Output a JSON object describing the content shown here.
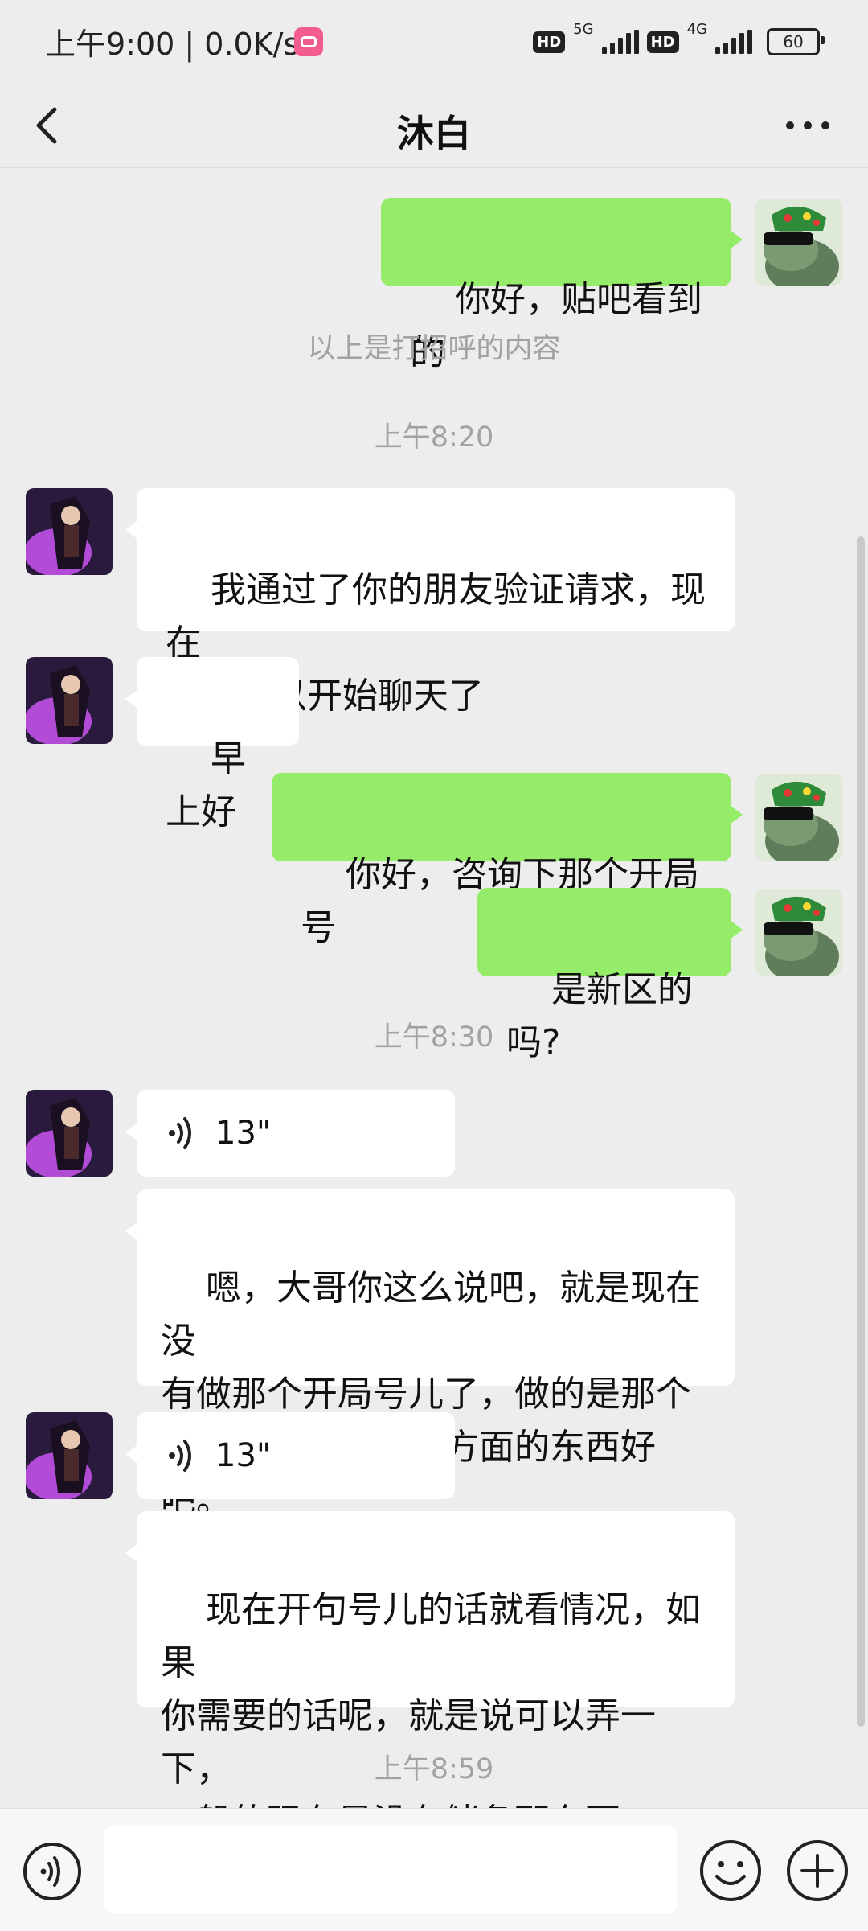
{
  "status_bar": {
    "time_speed": "上午9:00 | 0.0K/s",
    "hd1": "HD",
    "net1": "5G",
    "hd2": "HD",
    "net2": "4G",
    "battery": "60"
  },
  "header": {
    "title": "沐白"
  },
  "messages": {
    "m1": "你好，贴吧看到的",
    "greeting_note": "以上是打招呼的内容",
    "t1": "上午8:20",
    "m2": "我通过了你的朋友验证请求，现在\n我们可以开始聊天了",
    "m3": "早上好",
    "m4": "你好，咨询下那个开局号",
    "m5": "是新区的吗?",
    "t2": "上午8:30",
    "v1": "13\"",
    "m6": "嗯，大哥你这么说吧，就是现在没\n有做那个开局号儿了，做的是那个\n跟充值方充值优惠方面的东西好吧。",
    "v2": "13\"",
    "m7": "现在开句号儿的话就看情况，如果\n你需要的话呢，就是说可以弄一下，\n一般的现在是没有储备那东西。",
    "t3": "上午8:59"
  },
  "input": {
    "placeholder": "",
    "value": ""
  },
  "colors": {
    "outgoing_bubble": "#95ec69",
    "incoming_bubble": "#ffffff",
    "background": "#ededed"
  }
}
